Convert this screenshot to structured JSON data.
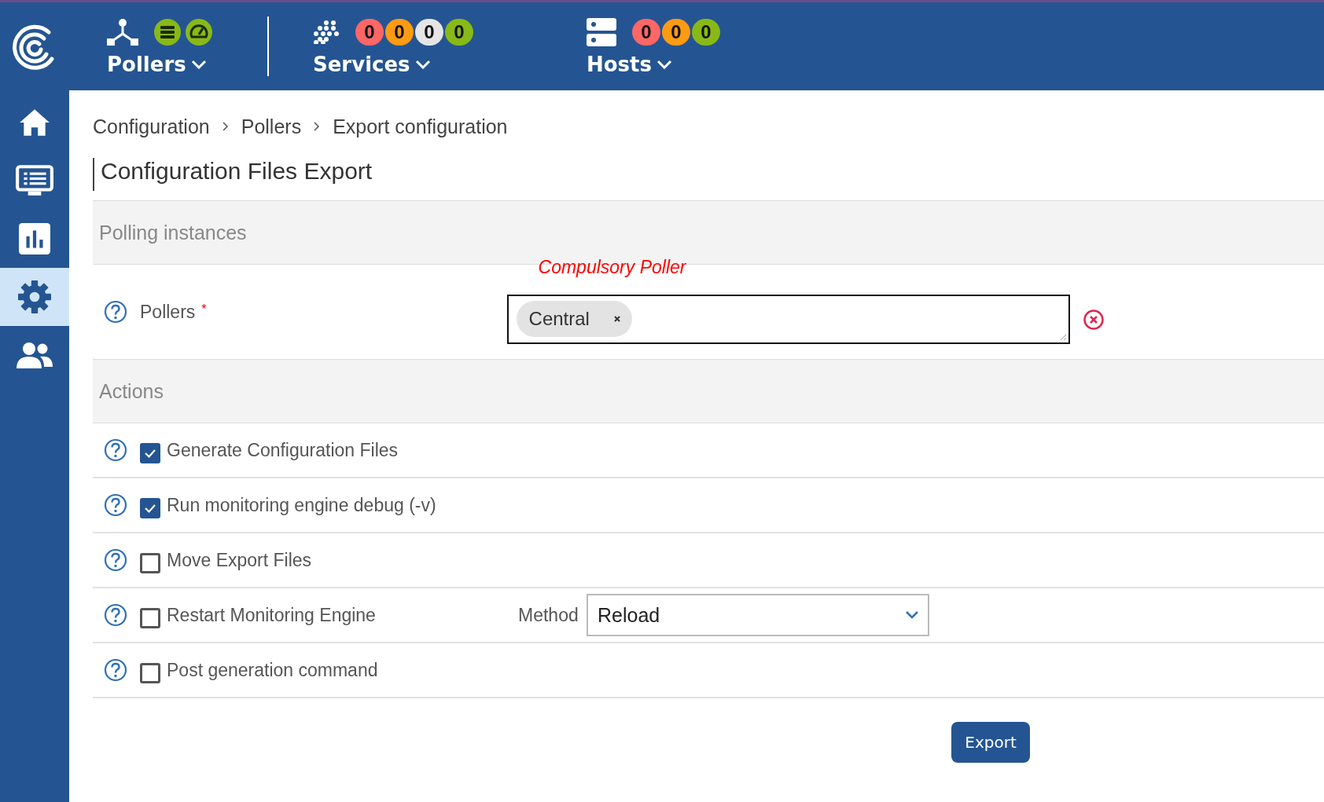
{
  "top_bar": {
    "groups": [
      {
        "kind": "pollers",
        "label": "Pollers"
      },
      {
        "kind": "services",
        "label": "Services",
        "counters": [
          {
            "value": "0",
            "color": "#ff6666"
          },
          {
            "value": "0",
            "color": "#ff9a13"
          },
          {
            "value": "0",
            "color": "#e5e5e5"
          },
          {
            "value": "0",
            "color": "#88b917"
          }
        ]
      },
      {
        "kind": "hosts",
        "label": "Hosts",
        "counters": [
          {
            "value": "0",
            "color": "#ff6666"
          },
          {
            "value": "0",
            "color": "#ff9a13"
          },
          {
            "value": "0",
            "color": "#88b917"
          }
        ]
      }
    ]
  },
  "sidebar": {
    "items": [
      {
        "kind": "home",
        "selected": false
      },
      {
        "kind": "monitoring",
        "selected": false
      },
      {
        "kind": "reporting",
        "selected": false
      },
      {
        "kind": "configuration",
        "selected": true
      },
      {
        "kind": "administration",
        "selected": false
      }
    ]
  },
  "breadcrumb": [
    "Configuration",
    "Pollers",
    "Export configuration"
  ],
  "page_title": "Configuration Files Export",
  "sections": [
    {
      "title": "Polling instances",
      "kind": "pollers",
      "label": "Pollers",
      "required_mark": "*",
      "error": "Compulsory Poller",
      "tags": [
        "Central"
      ]
    },
    {
      "title": "Actions",
      "kind": "actions",
      "rows": [
        {
          "label": "Generate Configuration Files",
          "checked": true
        },
        {
          "label": "Run monitoring engine debug (-v)",
          "checked": true
        },
        {
          "label": "Move Export Files",
          "checked": false
        },
        {
          "label": "Restart Monitoring Engine",
          "checked": false,
          "method": {
            "label": "Method",
            "value": "Reload"
          }
        },
        {
          "label": "Post generation command",
          "checked": false
        }
      ]
    }
  ],
  "export_button": "Export"
}
